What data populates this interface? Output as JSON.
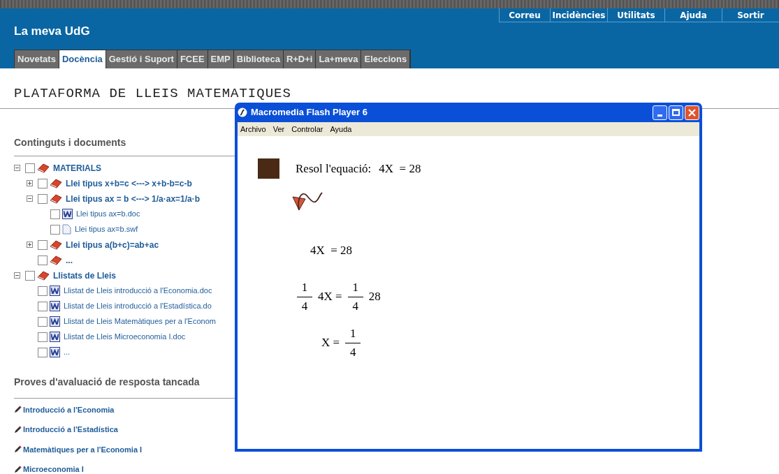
{
  "header": {
    "title": "La meva UdG",
    "links": [
      "Correu",
      "Incidències",
      "Utilitats",
      "Ajuda",
      "Sortir"
    ]
  },
  "tabs": [
    {
      "label": "Novetats",
      "selected": false
    },
    {
      "label": "Docència",
      "selected": true
    },
    {
      "label": "Gestió i Suport",
      "selected": false
    },
    {
      "label": "FCEE",
      "selected": false
    },
    {
      "label": "EMP",
      "selected": false
    },
    {
      "label": "Biblioteca",
      "selected": false
    },
    {
      "label": "R+D+i",
      "selected": false
    },
    {
      "label": "La+meva",
      "selected": false
    },
    {
      "label": "Eleccions",
      "selected": false
    }
  ],
  "page_title": "PLATAFORMA DE LLEIS MATEMATIQUES",
  "contents": {
    "heading": "Continguts i documents",
    "tree": [
      {
        "label": "MATERIALS",
        "kind": "book",
        "checked": false,
        "expanded": true,
        "children": [
          {
            "label": "Llei tipus x+b=c <---> x+b-b=c-b",
            "kind": "book",
            "checked": false,
            "expanded": false
          },
          {
            "label": "Llei tipus ax = b <---> 1/a·ax=1/a·b",
            "kind": "book",
            "checked": false,
            "expanded": true,
            "children": [
              {
                "label": "Llei tipus ax=b.doc",
                "kind": "word",
                "checked": false
              },
              {
                "label": "Llei tipus ax=b.swf",
                "kind": "file",
                "checked": false
              }
            ]
          },
          {
            "label": "Llei tipus a(b+c)=ab+ac",
            "kind": "book",
            "checked": false,
            "expanded": false
          },
          {
            "label": "...",
            "kind": "book",
            "checked": false
          }
        ]
      },
      {
        "label": "Llistats de Lleis",
        "kind": "book",
        "checked": false,
        "expanded": true,
        "children": [
          {
            "label": "Llistat de Lleis introducció a l'Economia.doc",
            "kind": "word",
            "checked": false
          },
          {
            "label": "Llistat de Lleis introducció a l'Estadística.do",
            "kind": "word",
            "checked": false
          },
          {
            "label": "Llistat de Lleis Matemàtiques per a l'Econom",
            "kind": "word",
            "checked": false
          },
          {
            "label": "Llistat de Lleis Microeconomia I.doc",
            "kind": "word",
            "checked": false
          },
          {
            "label": "...",
            "kind": "word",
            "checked": false
          }
        ]
      }
    ]
  },
  "tests": {
    "heading": "Proves d'avaluació de resposta tancada",
    "items": [
      "Introducció a l'Economia",
      "Introducció a l'Estadística",
      "Matemàtiques per a l'Economia I",
      "Microeconomia I"
    ]
  },
  "flash_window": {
    "title": "Macromedia Flash Player 6",
    "menu": [
      "Archivo",
      "Ver",
      "Controlar",
      "Ayuda"
    ],
    "prompt": "Resol l'equació:",
    "equation": "4X  = 28",
    "steps": [
      [
        {
          "kind": "text",
          "text": "4X  = 28"
        }
      ],
      [
        {
          "kind": "fraction",
          "num": "1",
          "den": "4"
        },
        {
          "kind": "text",
          "text": "4X ="
        },
        {
          "kind": "fraction",
          "num": "1",
          "den": "4"
        },
        {
          "kind": "text",
          "text": "28"
        }
      ],
      [
        {
          "kind": "text",
          "text": "X ="
        },
        {
          "kind": "fraction",
          "num": "1",
          "den": "4"
        }
      ]
    ]
  }
}
